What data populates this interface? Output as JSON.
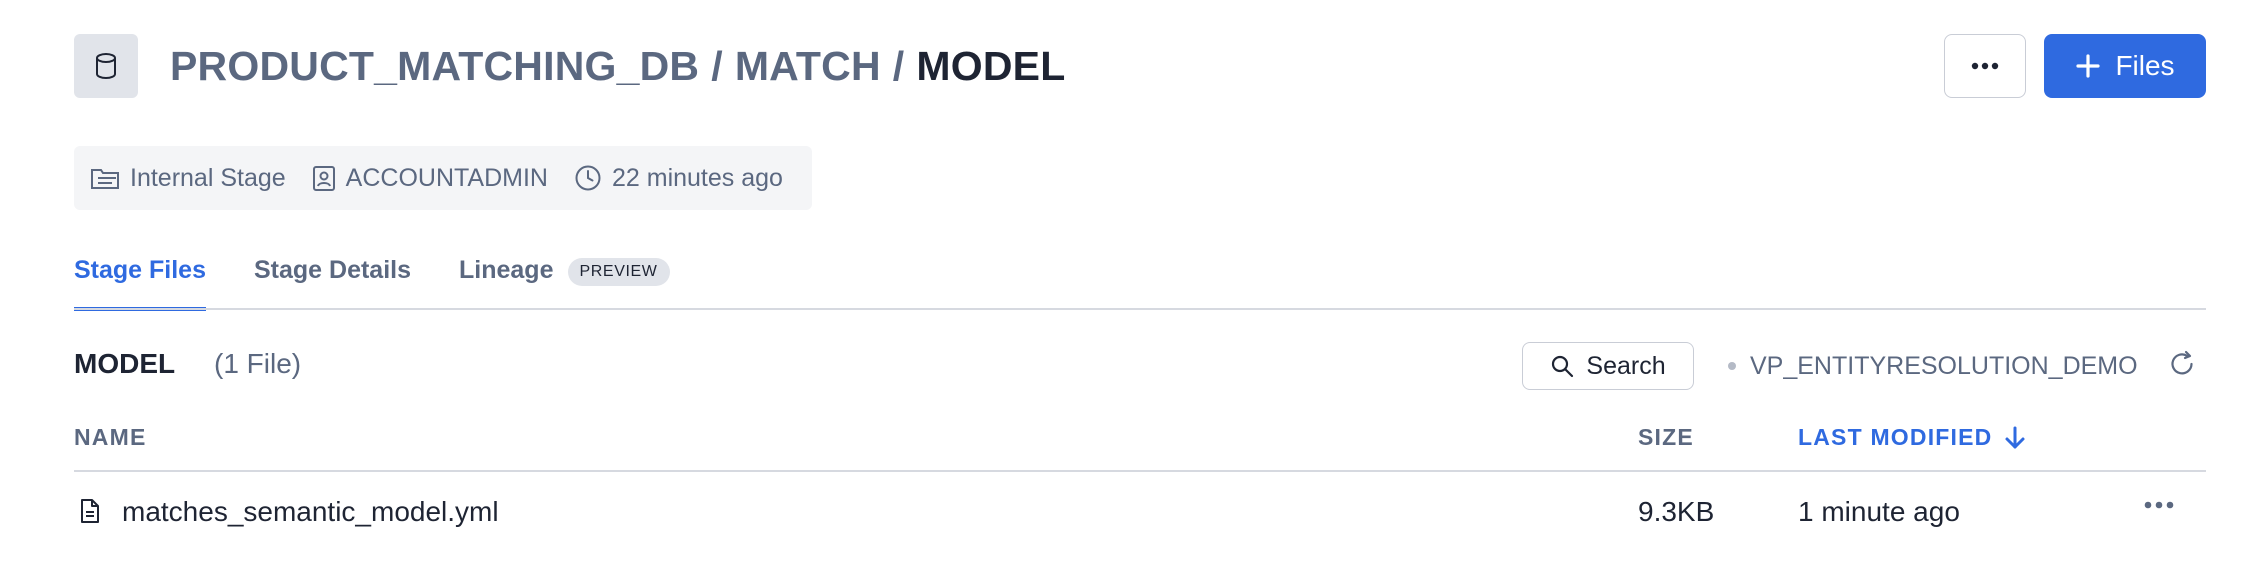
{
  "header": {
    "db_icon": "database-icon",
    "breadcrumb": {
      "database": "PRODUCT_MATCHING_DB",
      "schema": "MATCH",
      "separator": "/",
      "current": "MODEL"
    },
    "more_icon": "ellipsis-icon",
    "files_button": {
      "icon": "plus-icon",
      "label": "Files"
    }
  },
  "meta": {
    "stage_type": {
      "icon": "stage-icon",
      "label": "Internal Stage"
    },
    "owner": {
      "icon": "user-badge-icon",
      "label": "ACCOUNTADMIN"
    },
    "created": {
      "icon": "clock-icon",
      "label": "22 minutes ago"
    }
  },
  "tabs": [
    {
      "label": "Stage Files",
      "active": true
    },
    {
      "label": "Stage Details",
      "active": false
    },
    {
      "label": "Lineage",
      "active": false,
      "badge": "PREVIEW"
    }
  ],
  "section": {
    "title": "MODEL",
    "file_count": "(1 File)",
    "search_label": "Search",
    "warehouse": "VP_ENTITYRESOLUTION_DEMO",
    "refresh_icon": "refresh-icon"
  },
  "table": {
    "columns": {
      "name": "NAME",
      "size": "SIZE",
      "last_modified": "LAST MODIFIED"
    },
    "sort": {
      "column": "last_modified",
      "direction": "descending"
    },
    "rows": [
      {
        "icon": "file-icon",
        "name": "matches_semantic_model.yml",
        "size": "9.3KB",
        "last_modified": "1 minute ago"
      }
    ]
  },
  "colors": {
    "accent": "#2f6ae0",
    "text_primary": "#1e2433",
    "text_muted": "#5b6880",
    "border": "#c9cdd6"
  }
}
